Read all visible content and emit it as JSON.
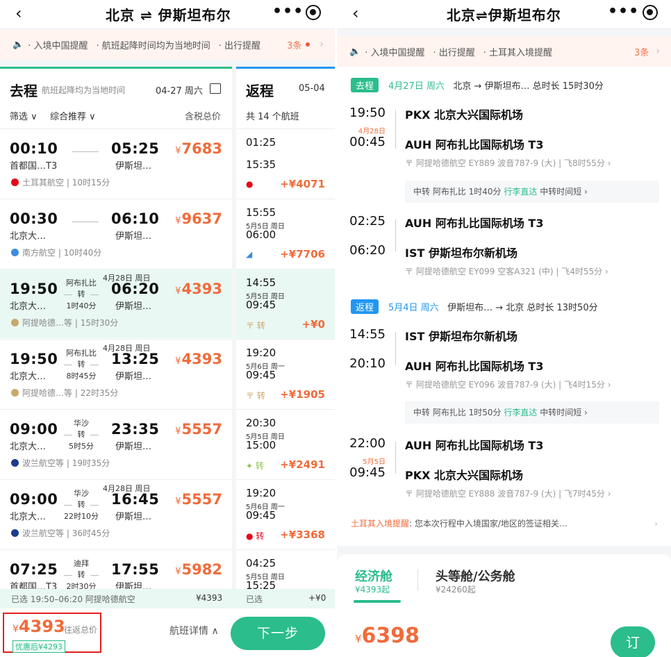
{
  "left": {
    "header": {
      "back": "‹",
      "title": "北京 ⇌ 伊斯坦布尔",
      "more": "•••"
    },
    "notice": {
      "items": [
        "· 入境中国提醒",
        "· 航班起降时间均为当地时间",
        "· 出行提醒"
      ],
      "count": "3条"
    },
    "outbound": {
      "title": "去程",
      "subtitle": "航班起降均为当地时间",
      "date": "04-27 周六",
      "filter": "筛选 ∨",
      "sort": "综合推荐 ∨",
      "price_label": "含税总价",
      "flights": [
        {
          "dep": "00:10",
          "dep_ap": "首都国…T3",
          "arr": "05:25",
          "arr_ap": "伊斯坦…",
          "price": "7683",
          "airline": "土耳其航空",
          "dur": "10时15分",
          "via": "",
          "via_dur": "",
          "next": "",
          "icon_color": "#e30a17"
        },
        {
          "dep": "00:30",
          "dep_ap": "北京大…",
          "arr": "06:10",
          "arr_ap": "伊斯坦…",
          "price": "9637",
          "airline": "南方航空",
          "dur": "10时40分",
          "via": "",
          "via_dur": "",
          "next": "",
          "icon_color": "#3c8ce0"
        },
        {
          "dep": "19:50",
          "dep_ap": "北京大…",
          "arr": "06:20",
          "arr_ap": "伊斯坦…",
          "price": "4393",
          "airline": "阿提哈德…等",
          "dur": "15时30分",
          "via": "阿布扎比",
          "via_dur": "1时40分",
          "next": "4月28日 周日",
          "icon_color": "#c9a86b"
        },
        {
          "dep": "19:50",
          "dep_ap": "北京大…",
          "arr": "13:25",
          "arr_ap": "伊斯坦…",
          "price": "4393",
          "airline": "阿提哈德…等",
          "dur": "22时35分",
          "via": "阿布扎比",
          "via_dur": "8时45分",
          "next": "4月28日 周日",
          "icon_color": "#c9a86b"
        },
        {
          "dep": "09:00",
          "dep_ap": "北京大…",
          "arr": "23:35",
          "arr_ap": "伊斯坦…",
          "price": "5557",
          "airline": "波兰航空等",
          "dur": "19时35分",
          "via": "华沙",
          "via_dur": "5时5分",
          "next": "",
          "icon_color": "#1e3c8c"
        },
        {
          "dep": "09:00",
          "dep_ap": "北京大…",
          "arr": "16:45",
          "arr_ap": "伊斯坦…",
          "price": "5557",
          "airline": "波兰航空等",
          "dur": "36时45分",
          "via": "华沙",
          "via_dur": "22时10分",
          "next": "4月28日 周日",
          "icon_color": "#1e3c8c"
        },
        {
          "dep": "07:25",
          "dep_ap": "首都国…T3",
          "arr": "17:55",
          "arr_ap": "伊斯坦…",
          "price": "5982",
          "airline": "",
          "dur": "",
          "via": "迪拜",
          "via_dur": "2时30分",
          "next": "",
          "icon_color": "#c9a86b"
        }
      ],
      "transfer_word": "转",
      "selected": "已选  19:50–06:20 阿提哈德航空",
      "selected_price": "¥4393"
    },
    "return": {
      "title": "返程",
      "date": "05-04",
      "count": "共 14 个航班",
      "flights": [
        {
          "t1": "01:25",
          "sub": "",
          "t2": "15:35",
          "price": "+¥4071",
          "icon": "●",
          "icon_color": "#e30a17"
        },
        {
          "t1": "15:55",
          "sub": "5月5日 周日",
          "t2": "06:00",
          "price": "+¥7706",
          "icon": "◢",
          "icon_color": "#3c8ce0"
        },
        {
          "t1": "14:55",
          "sub": "5月5日 周日",
          "t2": "09:45",
          "price": "+¥0",
          "icon": "〒 转",
          "icon_color": "#c9a86b"
        },
        {
          "t1": "19:20",
          "sub": "5月6日 周一",
          "t2": "09:45",
          "price": "+¥1905",
          "icon": "〒 转",
          "icon_color": "#c9a86b"
        },
        {
          "t1": "20:30",
          "sub": "5月5日 周日",
          "t2": "15:00",
          "price": "+¥2491",
          "icon": "✦ 转",
          "icon_color": "#8bc34a"
        },
        {
          "t1": "19:20",
          "sub": "5月6日 周一",
          "t2": "09:45",
          "price": "+¥3368",
          "icon": "● 转",
          "icon_color": "#e30a17"
        },
        {
          "t1": "04:25",
          "sub": "5月5日 周日",
          "t2": "15:25",
          "price": "",
          "icon": "",
          "icon_color": "#888"
        }
      ],
      "selected": "已选",
      "selected_price": "+¥0"
    },
    "bottom": {
      "total_price": "4393",
      "total_label": "往返总价",
      "discount": "优惠后¥4293",
      "details": "航班详情 ∧",
      "next": "下一步"
    }
  },
  "right": {
    "header": {
      "back": "‹",
      "title": "北京⇌伊斯坦布尔",
      "more": "•••"
    },
    "notice": {
      "items": [
        "· 入境中国提醒",
        "· 出行提醒",
        "· 土耳其入境提醒"
      ],
      "count": "3条"
    },
    "outbound": {
      "tag": "去程",
      "date": "4月27日 周六",
      "route": "北京 → 伊斯坦布…  总时长 15时30分",
      "seg1": {
        "dep_time": "19:50",
        "next": "4月28日",
        "arr_time": "00:45",
        "dep_ap": "PKX 北京大兴国际机场",
        "arr_ap": "AUH 阿布扎比国际机场 T3",
        "info": "〒 阿提哈德航空 EY889  波音787-9 (大) | 飞8时55分 ›"
      },
      "transfer": {
        "a": "中转 阿布扎比 1时40分  ",
        "b": "行李直达",
        "c": "  中转时间短 ›"
      },
      "seg2": {
        "dep_time": "02:25",
        "arr_time": "06:20",
        "dep_ap": "AUH 阿布扎比国际机场 T3",
        "arr_ap": "IST 伊斯坦布尔新机场",
        "info": "〒 阿提哈德航空 EY099  空客A321 (中) | 飞4时55分 ›"
      }
    },
    "return": {
      "tag": "返程",
      "date": "5月4日 周六",
      "route": "伊斯坦布… → 北京  总时长 13时50分",
      "seg1": {
        "dep_time": "14:55",
        "arr_time": "20:10",
        "dep_ap": "IST 伊斯坦布尔新机场",
        "arr_ap": "AUH 阿布扎比国际机场 T3",
        "info": "〒 阿提哈德航空 EY096  波音787-9 (大) | 飞4时15分 ›"
      },
      "transfer": {
        "a": "中转 阿布扎比 1时50分  ",
        "b": "行李直达",
        "c": "  中转时间短 ›"
      },
      "seg2": {
        "dep_time": "22:00",
        "next": "5月5日",
        "arr_time": "09:45",
        "dep_ap": "AUH 阿布扎比国际机场 T3",
        "arr_ap": "PKX 北京大兴国际机场",
        "info": "〒 阿提哈德航空 EY888  波音787-9 (大) | 飞7时45分 ›"
      }
    },
    "visa": {
      "label": "土耳其入境提醒",
      "text": ":  您本次行程中入境国家/地区的签证相关…"
    },
    "cabin": {
      "eco": "经济舱",
      "eco_price": "¥4393起",
      "biz": "头等舱/公务舱",
      "biz_price": "¥24260起",
      "price": "6398",
      "book": "订"
    }
  },
  "currency": "¥",
  "colors": {
    "green": "#2bbd8c",
    "orange": "#f06b3a",
    "blue": "#2196f3"
  }
}
